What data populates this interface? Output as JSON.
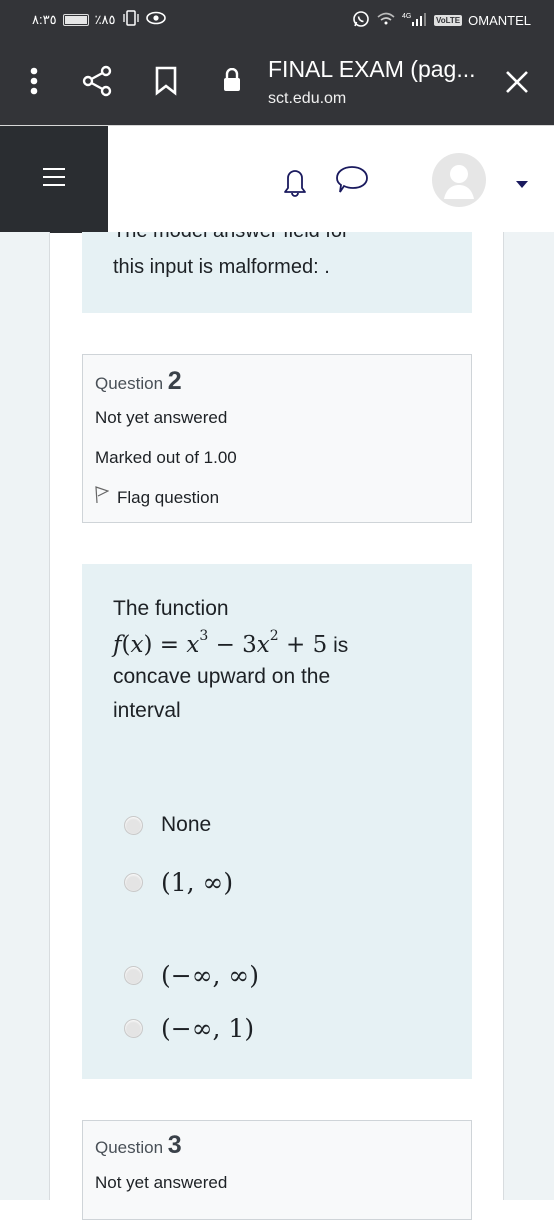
{
  "status_bar": {
    "time": "٨:٣٥",
    "battery_percent": "٪٨٥",
    "network": "4G",
    "volte_label": "VoLTE",
    "carrier": "OMANTEL"
  },
  "browser": {
    "title": "FINAL EXAM (pag...",
    "url": "sct.edu.om",
    "icons": [
      "more-vert-icon",
      "share-icon",
      "bookmark-icon",
      "lock-icon",
      "close-icon"
    ]
  },
  "navbar": {
    "icons": [
      "hamburger-menu-icon",
      "bell-icon",
      "chat-bubble-icon",
      "avatar",
      "caret-down-icon"
    ]
  },
  "previous_question": {
    "text_line1": "The model answer field for",
    "text_line2": "this input is malformed: ."
  },
  "question2": {
    "label": "Question",
    "number": "2",
    "state": "Not yet answered",
    "marks": "Marked out of 1.00",
    "flag_label": "Flag question",
    "text_intro": "The  function",
    "formula_suffix": " is",
    "text_line3": "concave upward on the",
    "text_line4": "interval",
    "options": [
      {
        "label": "None",
        "selected": false
      },
      {
        "label": "(1, ∞)",
        "selected": false
      },
      {
        "label": "(−∞, ∞)",
        "selected": false
      },
      {
        "label": "(−∞, 1)",
        "selected": false
      }
    ]
  },
  "question3": {
    "label": "Question",
    "number": "3",
    "state": "Not yet answered"
  }
}
